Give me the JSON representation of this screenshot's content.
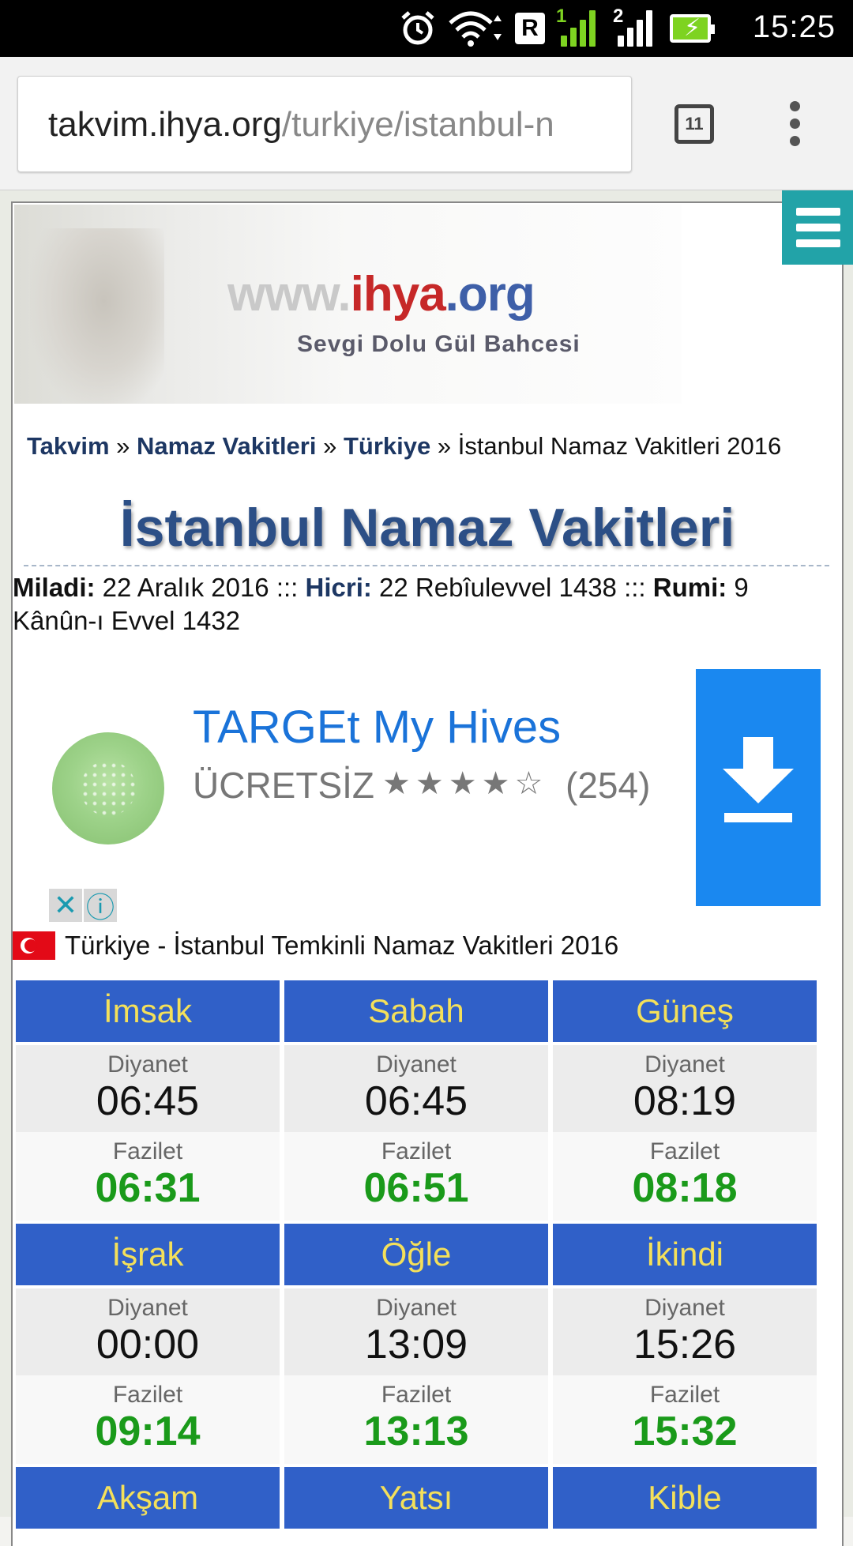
{
  "status_bar": {
    "time": "15:25",
    "roaming": "R",
    "sim1": "1",
    "sim2": "2",
    "icons": [
      "alarm-icon",
      "wifi-icon",
      "signal-icon",
      "battery-charging-icon"
    ]
  },
  "browser": {
    "url_host": "takvim.ihya.org",
    "url_path": "/turkiye/istanbul-n",
    "tab_count": "11"
  },
  "banner": {
    "logo_www": "www.",
    "logo_ihya": "ihya",
    "logo_org": ".org",
    "slogan": "Sevgi Dolu Gül Bahcesi"
  },
  "breadcrumb": {
    "item1": "Takvim",
    "item2": "Namaz Vakitleri",
    "item3": "Türkiye",
    "sep": " » ",
    "current": "İstanbul Namaz Vakitleri 2016"
  },
  "page_title": "İstanbul Namaz Vakitleri",
  "dates": {
    "miladi_label": "Miladi:",
    "miladi_value": " 22 Aralık 2016 ::: ",
    "hicri_label": "Hicri:",
    "hicri_value": " 22 Rebîulevvel 1438 ::: ",
    "rumi_label": "Rumi:",
    "rumi_value": " 9 Kânûn-ı Evvel 1432"
  },
  "ad": {
    "title": "TARGEt My Hives",
    "price": "ÜCRETSİZ",
    "stars": "★★★★☆",
    "rating_count": "(254)"
  },
  "location_line": "Türkiye - İstanbul Temkinli Namaz Vakitleri 2016",
  "table": {
    "diyanet_label": "Diyanet",
    "fazilet_label": "Fazilet",
    "rows": [
      {
        "name": "İmsak",
        "diyanet": "06:45",
        "fazilet": "06:31"
      },
      {
        "name": "Sabah",
        "diyanet": "06:45",
        "fazilet": "06:51"
      },
      {
        "name": "Güneş",
        "diyanet": "08:19",
        "fazilet": "08:18"
      },
      {
        "name": "İşrak",
        "diyanet": "00:00",
        "fazilet": "09:14"
      },
      {
        "name": "Öğle",
        "diyanet": "13:09",
        "fazilet": "13:13"
      },
      {
        "name": "İkindi",
        "diyanet": "15:26",
        "fazilet": "15:32"
      },
      {
        "name": "Akşam"
      },
      {
        "name": "Yatsı"
      },
      {
        "name": "Kible"
      }
    ]
  }
}
